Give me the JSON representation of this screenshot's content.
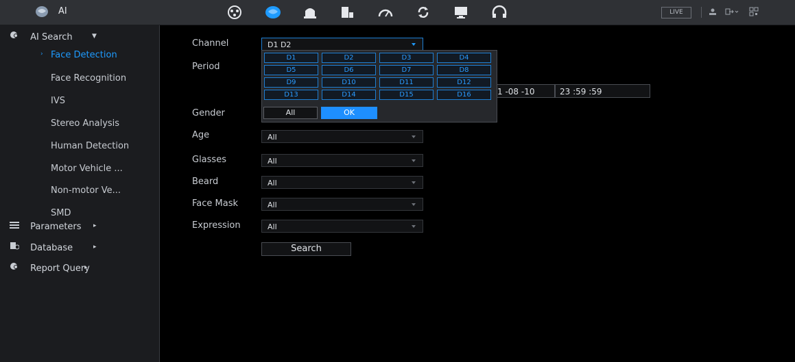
{
  "topbar": {
    "app_title": "AI",
    "nav_icons": [
      "playback-icon",
      "ai-brain-icon",
      "alarm-bell-icon",
      "storage-icon",
      "performance-gauge-icon",
      "sync-icon",
      "display-icon",
      "headset-icon"
    ],
    "live_label": "LIVE",
    "active_nav_color": "#1e9bff"
  },
  "sidebar": {
    "ai_search": "AI Search",
    "sub_items": [
      "Face Detection",
      "Face Recognition",
      "IVS",
      "Stereo Analysis",
      "Human Detection",
      "Motor Vehicle ...",
      "Non-motor Ve...",
      "SMD"
    ],
    "active_sub": "Face Detection",
    "parameters": "Parameters",
    "database": "Database",
    "report_query": "Report Query"
  },
  "form": {
    "channel_label": "Channel",
    "channel_value": "D1 D2",
    "period_label": "Period",
    "period_end_date": "1 -08 -10",
    "period_end_time": "23 :59 :59",
    "gender_label": "Gender",
    "age_label": "Age",
    "age_value": "All",
    "glasses_label": "Glasses",
    "glasses_value": "All",
    "beard_label": "Beard",
    "beard_value": "All",
    "face_mask_label": "Face Mask",
    "face_mask_value": "All",
    "expression_label": "Expression",
    "expression_value": "All",
    "search_label": "Search"
  },
  "channel_popup": {
    "channels": [
      "D1",
      "D2",
      "D3",
      "D4",
      "D5",
      "D6",
      "D7",
      "D8",
      "D9",
      "D10",
      "D11",
      "D12",
      "D13",
      "D14",
      "D15",
      "D16"
    ],
    "all_label": "All",
    "ok_label": "OK"
  }
}
